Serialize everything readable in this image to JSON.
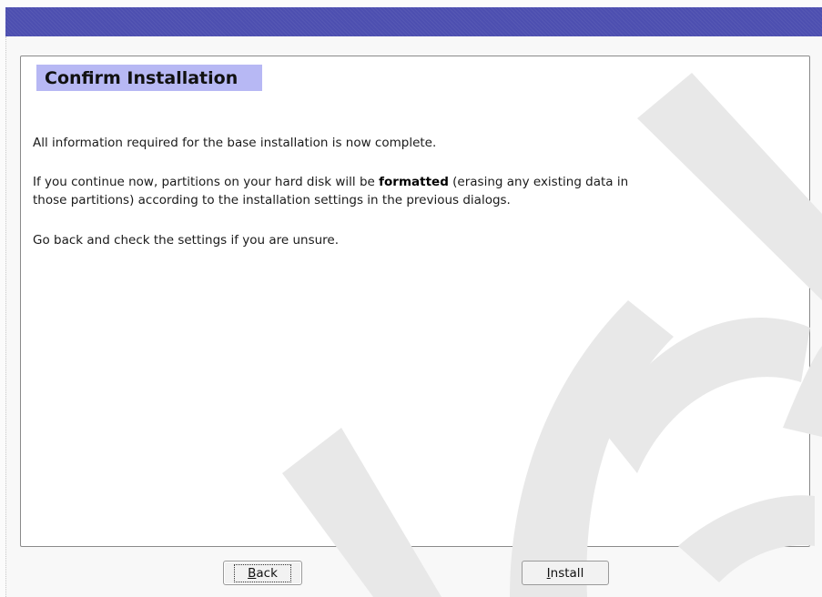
{
  "dialog": {
    "title": "Confirm Installation",
    "paragraphs": {
      "p1": "All information required for the base installation is now complete.",
      "p2_pre": "If you continue now, partitions on your hard disk will be ",
      "p2_bold": "formatted",
      "p2_post": " (erasing any existing data in",
      "p2_line2": "those partitions) according to the installation settings in the previous dialogs.",
      "p3": "Go back and check the settings if you are unsure."
    }
  },
  "buttons": {
    "back": {
      "mnemonic": "B",
      "rest": "ack"
    },
    "install": {
      "mnemonic": "I",
      "rest": "nstall"
    }
  },
  "colors": {
    "titlebar": "#4d4fb0",
    "heading_bg": "#b7b8f4",
    "watermark": "#e6e6e6"
  }
}
